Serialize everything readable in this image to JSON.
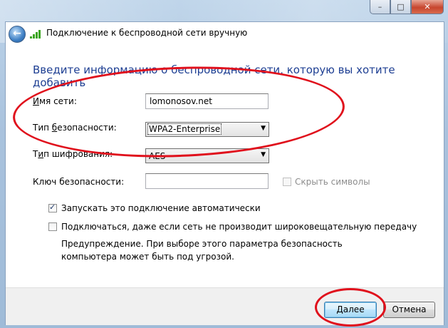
{
  "window": {
    "title": "Подключение к беспроводной сети вручную",
    "caption_buttons": {
      "minimize": "–",
      "maximize": "□",
      "close": "✕"
    },
    "back_glyph": "←"
  },
  "heading": "Введите информацию о беспроводной сети, которую вы хотите добавить",
  "form": {
    "network_name": {
      "label": "Имя сети:",
      "label_accel": "И",
      "label_rest": "мя сети:",
      "value": "lomonosov.net"
    },
    "security_type": {
      "label_pre": "Тип ",
      "label_accel": "б",
      "label_rest": "езопасности:",
      "value": "WPA2-Enterprise"
    },
    "encryption_type": {
      "label_pre": "Т",
      "label_accel": "и",
      "label_rest": "п шифрования:",
      "value": "AES"
    },
    "security_key": {
      "label": "Ключ безопасности:",
      "value": ""
    },
    "hide_chars": {
      "label": "Скрыть символы",
      "checked": false,
      "enabled": false
    }
  },
  "options": {
    "auto_start": {
      "label": "Запускать это подключение автоматически",
      "checked": true
    },
    "connect_hidden": {
      "label": "Подключаться, даже если сеть не производит широковещательную передачу",
      "checked": false
    }
  },
  "warning": "Предупреждение. При выборе этого параметра безопасность компьютера может быть под угрозой.",
  "buttons": {
    "next": "Далее",
    "cancel": "Отмена"
  },
  "annotation_color": "#e0101c"
}
